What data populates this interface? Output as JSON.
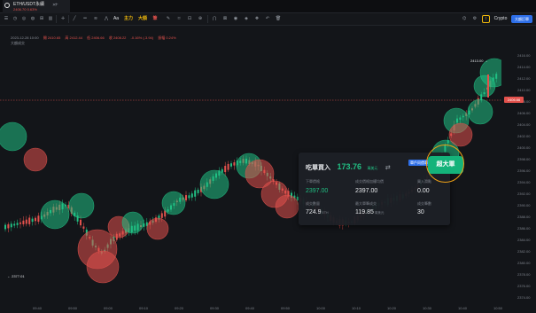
{
  "tab": {
    "symbol": "ETH/USDT永續",
    "change": "2406.70  0.63%",
    "close": "✕",
    "add": "+"
  },
  "toolbar": {
    "intervals": [
      "Aa",
      "主力",
      "大額",
      "筆"
    ],
    "interval_types": [
      "white",
      "gold",
      "gold",
      "red"
    ],
    "right_label": "Crypto",
    "right_button": "大額訂單"
  },
  "info": {
    "ohlc": [
      "2023-12-28 10:00",
      "開 2410.65",
      "高 2412.44",
      "低 2406.66",
      "收 2408.22",
      "-0.16% (-3.94)",
      "振幅 0.24%"
    ],
    "indicator": "大額成交"
  },
  "price_tag": "2406.66",
  "peak_label": "2413.00 →",
  "low_label": "← 2377.01",
  "y_axis": [
    "2416.00",
    "2414.00",
    "2412.00",
    "2410.00",
    "2408.00",
    "2406.00",
    "2404.00",
    "2402.00",
    "2400.00",
    "2398.00",
    "2396.00",
    "2394.00",
    "2392.00",
    "2390.00",
    "2388.00",
    "2386.00",
    "2384.00",
    "2382.00",
    "2380.00",
    "2378.00",
    "2376.00",
    "2374.00"
  ],
  "x_axis": [
    "09:40",
    "09:50",
    "09:00",
    "09:10",
    "09:20",
    "09:30",
    "09:40",
    "09:50",
    "10:00",
    "10:10",
    "10:20",
    "10:30",
    "10:40",
    "10:50"
  ],
  "card": {
    "title": "吃單買入",
    "amount": "173.76",
    "unit": "萬美元",
    "swap_icon": "⇄",
    "badge": "單戶同價單",
    "big_button": "超大單",
    "cells": [
      {
        "label": "下單價格",
        "value": "2397.00",
        "unit": "",
        "green": true
      },
      {
        "label": "成交價格加權均價",
        "value": "2397.00",
        "unit": "",
        "green": false
      },
      {
        "label": "買入滑點",
        "value": "0.00",
        "unit": "",
        "green": false
      },
      {
        "label": "成交數量",
        "value": "724.9",
        "unit": "ETH",
        "green": false
      },
      {
        "label": "最大單筆成交",
        "value": "119.85",
        "unit": "萬美元",
        "green": false
      },
      {
        "label": "成交筆數",
        "value": "30",
        "unit": "",
        "green": false
      }
    ]
  },
  "colors": {
    "up": "#21bf83",
    "down": "#e2514c",
    "accent": "#f0a216",
    "blue": "#2e6fe8"
  }
}
